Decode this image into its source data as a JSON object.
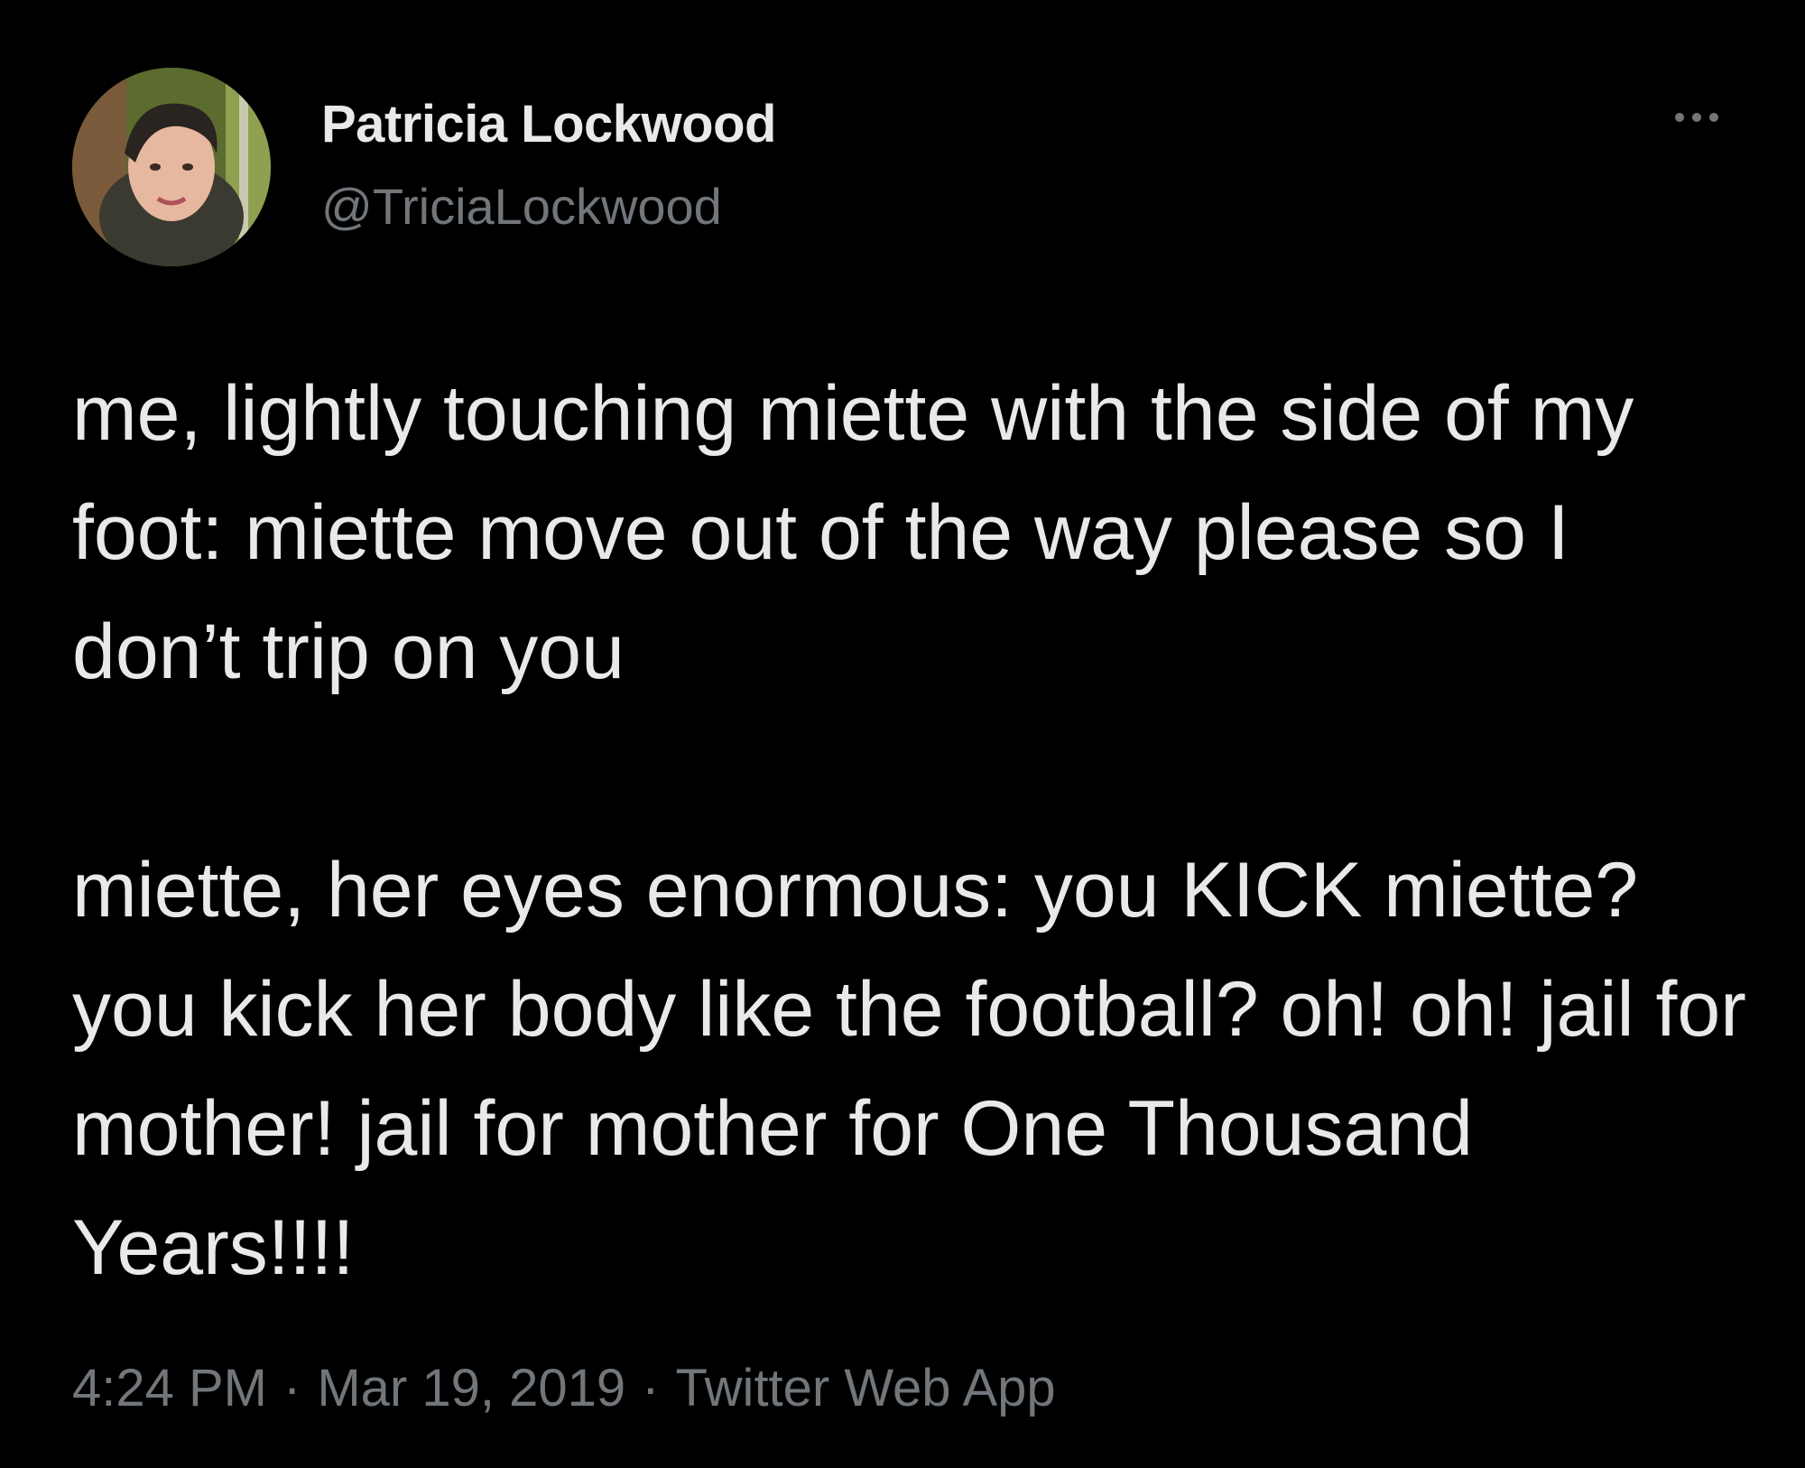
{
  "tweet": {
    "author": {
      "display_name": "Patricia Lockwood",
      "handle": "@TriciaLockwood"
    },
    "more_icon": "more-horizontal-icon",
    "text": "me, lightly touching miette with the side of my foot: miette move out of the way please so I don’t trip on you\n\nmiette, her eyes enormous: you KICK miette? you kick her body like the football? oh! oh! jail for mother! jail for mother for One Thousand Years!!!!",
    "meta": {
      "time": "4:24 PM",
      "separator": "·",
      "date": "Mar 19, 2019",
      "source": "Twitter Web App"
    }
  },
  "colors": {
    "background": "#000000",
    "primary_text": "#e7e9ea",
    "secondary_text": "#71767b"
  }
}
